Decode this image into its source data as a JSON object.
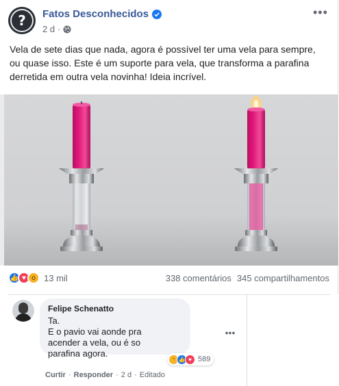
{
  "post": {
    "page_name": "Fatos Desconhecidos",
    "time": "2 d",
    "dot": "·",
    "text": "Vela de sete dias que nada, agora é possível ter uma vela para sempre, ou quase isso. Este é um suporte para vela, que transforma a parafina derretida em outra vela novinha! Ideia incrível.",
    "reaction_count": "13 mil",
    "comments_count": "338 comentários",
    "shares_count": "345 compartilhamentos",
    "verified_color": "#1877f2",
    "candle_color": "#e2197a"
  },
  "comment": {
    "author": "Felipe Schenatto",
    "lines": [
      "Ta.",
      "E o pavio vai aonde pra",
      "acender a vela, ou é so",
      "parafina agora."
    ],
    "reaction_count": "589",
    "actions": {
      "like": "Curtir",
      "reply": "Responder",
      "time": "2 d",
      "edited": "Editado",
      "dot": "·"
    }
  }
}
